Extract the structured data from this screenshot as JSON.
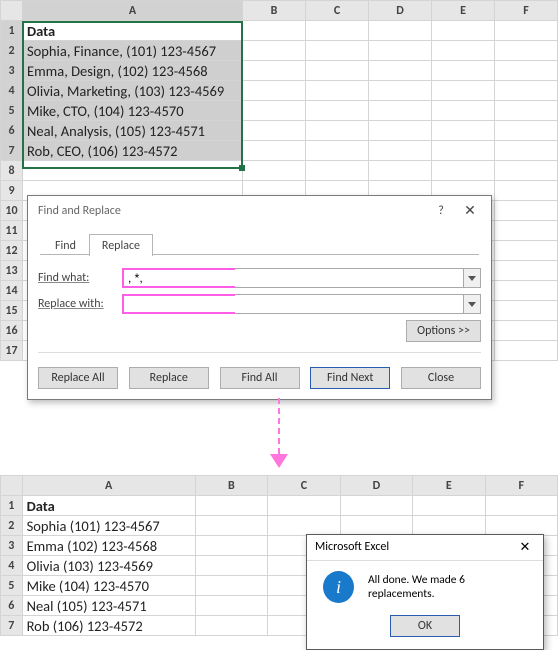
{
  "top_sheet": {
    "col_headers": [
      "A",
      "B",
      "C",
      "D",
      "E",
      "F"
    ],
    "row_headers": [
      "1",
      "2",
      "3",
      "4",
      "5",
      "6",
      "7",
      "8",
      "9",
      "10",
      "11",
      "12",
      "13",
      "14",
      "15",
      "16",
      "17"
    ],
    "header": "Data",
    "rows": [
      "Sophia, Finance, (101) 123-4567",
      "Emma, Design, (102) 123-4568",
      "Olivia, Marketing, (103) 123-4569",
      "Mike, CTO, (104) 123-4570",
      "Neal, Analysis, (105) 123-4571",
      "Rob, CEO, (106) 123-4572"
    ]
  },
  "find_replace": {
    "title": "Find and Replace",
    "help": "?",
    "close": "✕",
    "tab_find": "Find",
    "tab_replace": "Replace",
    "find_label": "Find what:",
    "replace_label": "Replace with:",
    "find_value": ", *,",
    "replace_value": "",
    "options_btn": "Options >>",
    "btn_replace_all": "Replace All",
    "btn_replace": "Replace",
    "btn_find_all": "Find All",
    "btn_find_next": "Find Next",
    "btn_close": "Close"
  },
  "bottom_sheet": {
    "col_headers": [
      "A",
      "B",
      "C",
      "D",
      "E",
      "F"
    ],
    "row_headers": [
      "1",
      "2",
      "3",
      "4",
      "5",
      "6",
      "7"
    ],
    "header": "Data",
    "rows": [
      "Sophia (101) 123-4567",
      "Emma (102) 123-4568",
      "Olivia (103) 123-4569",
      "Mike (104) 123-4570",
      "Neal (105) 123-4571",
      "Rob (106) 123-4572"
    ]
  },
  "alert": {
    "title": "Microsoft Excel",
    "close": "✕",
    "message": "All done. We made 6 replacements.",
    "ok": "OK"
  }
}
